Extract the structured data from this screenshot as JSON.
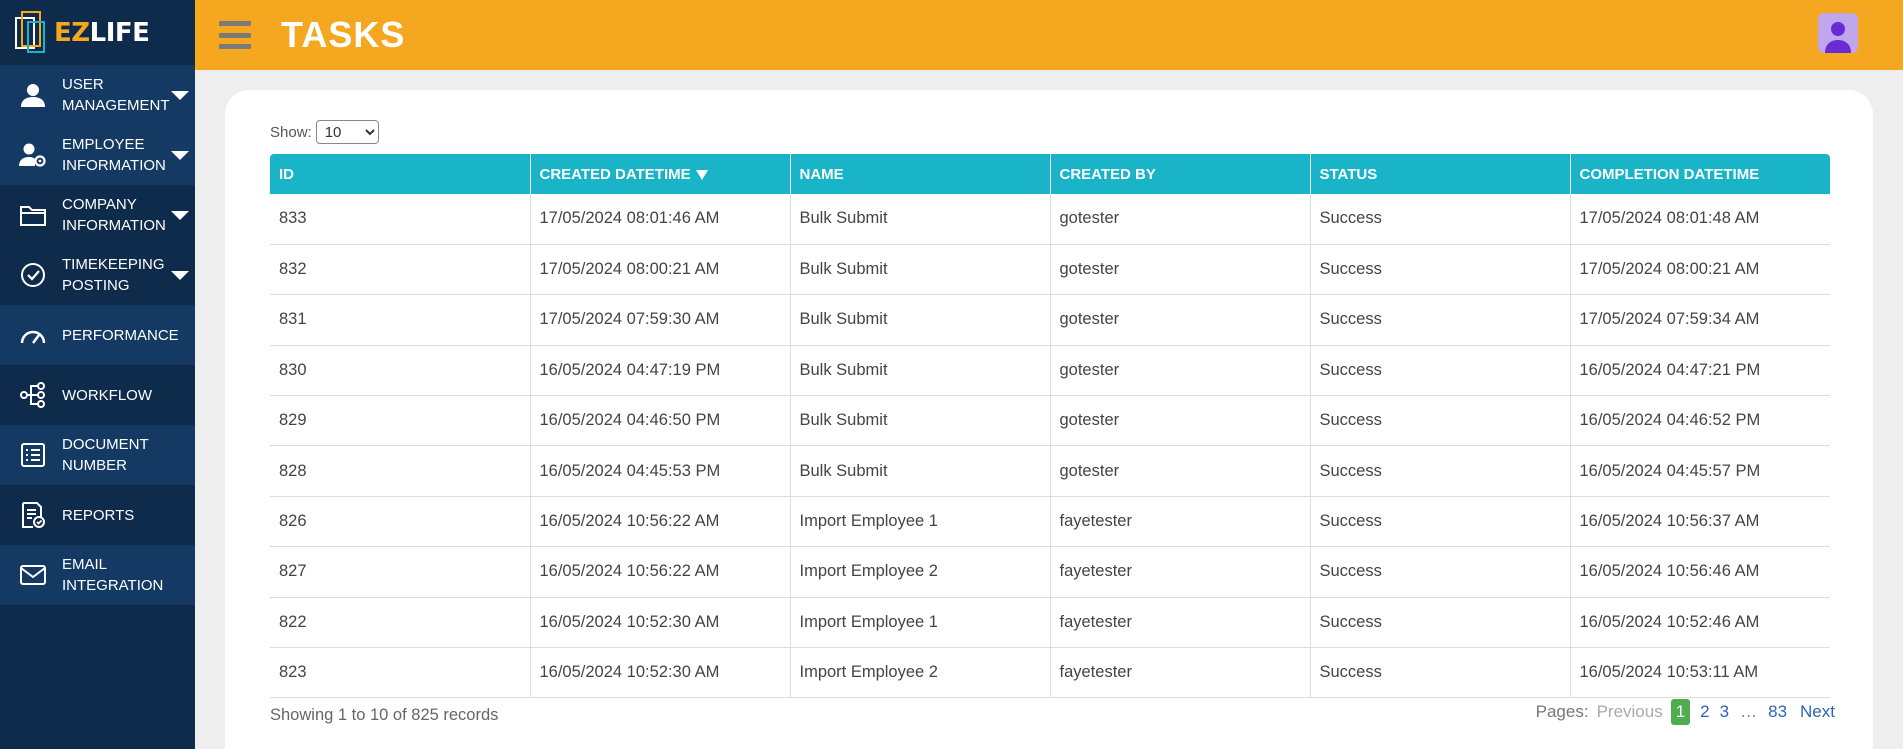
{
  "app": {
    "logo_ez": "EZ",
    "logo_life": "LIFE"
  },
  "sidebar": {
    "items": [
      {
        "label": "USER MANAGEMENT",
        "icon": "user-icon",
        "expandable": true
      },
      {
        "label": "EMPLOYEE INFORMATION",
        "icon": "user-gear-icon",
        "expandable": true
      },
      {
        "label": "COMPANY INFORMATION",
        "icon": "folder-icon",
        "expandable": true
      },
      {
        "label": "TIMEKEEPING POSTING",
        "icon": "check-circle-icon",
        "expandable": true
      },
      {
        "label": "PERFORMANCE",
        "icon": "gauge-icon",
        "expandable": false
      },
      {
        "label": "WORKFLOW",
        "icon": "workflow-icon",
        "expandable": false
      },
      {
        "label": "DOCUMENT NUMBER",
        "icon": "list-icon",
        "expandable": false
      },
      {
        "label": "REPORTS",
        "icon": "report-icon",
        "expandable": false
      },
      {
        "label": "EMAIL INTEGRATION",
        "icon": "mail-icon",
        "expandable": false
      }
    ]
  },
  "header": {
    "title": "TASKS"
  },
  "table_controls": {
    "show_label": "Show:",
    "page_size": "10",
    "page_size_options": [
      "10"
    ]
  },
  "table": {
    "columns": [
      "ID",
      "CREATED DATETIME",
      "NAME",
      "CREATED BY",
      "STATUS",
      "COMPLETION DATETIME"
    ],
    "sorted_column": "CREATED DATETIME",
    "rows": [
      [
        "833",
        "17/05/2024 08:01:46 AM",
        "Bulk Submit",
        "gotester",
        "Success",
        "17/05/2024 08:01:48 AM"
      ],
      [
        "832",
        "17/05/2024 08:00:21 AM",
        "Bulk Submit",
        "gotester",
        "Success",
        "17/05/2024 08:00:21 AM"
      ],
      [
        "831",
        "17/05/2024 07:59:30 AM",
        "Bulk Submit",
        "gotester",
        "Success",
        "17/05/2024 07:59:34 AM"
      ],
      [
        "830",
        "16/05/2024 04:47:19 PM",
        "Bulk Submit",
        "gotester",
        "Success",
        "16/05/2024 04:47:21 PM"
      ],
      [
        "829",
        "16/05/2024 04:46:50 PM",
        "Bulk Submit",
        "gotester",
        "Success",
        "16/05/2024 04:46:52 PM"
      ],
      [
        "828",
        "16/05/2024 04:45:53 PM",
        "Bulk Submit",
        "gotester",
        "Success",
        "16/05/2024 04:45:57 PM"
      ],
      [
        "826",
        "16/05/2024 10:56:22 AM",
        "Import Employee 1",
        "fayetester",
        "Success",
        "16/05/2024 10:56:37 AM"
      ],
      [
        "827",
        "16/05/2024 10:56:22 AM",
        "Import Employee 2",
        "fayetester",
        "Success",
        "16/05/2024 10:56:46 AM"
      ],
      [
        "822",
        "16/05/2024 10:52:30 AM",
        "Import Employee 1",
        "fayetester",
        "Success",
        "16/05/2024 10:52:46 AM"
      ],
      [
        "823",
        "16/05/2024 10:52:30 AM",
        "Import Employee 2",
        "fayetester",
        "Success",
        "16/05/2024 10:53:11 AM"
      ]
    ]
  },
  "footer": {
    "summary": "Showing 1 to 10 of  825 records",
    "pages_label": "Pages:",
    "previous": "Previous",
    "pages": [
      "1",
      "2",
      "3"
    ],
    "ellipsis": "…",
    "last_page": "83",
    "next": "Next",
    "current_page": "1"
  },
  "colors": {
    "sidebar": "#0f2b4c",
    "header": "#f5a81f",
    "table_header": "#1ab4c9",
    "active_page": "#4fad4f"
  }
}
